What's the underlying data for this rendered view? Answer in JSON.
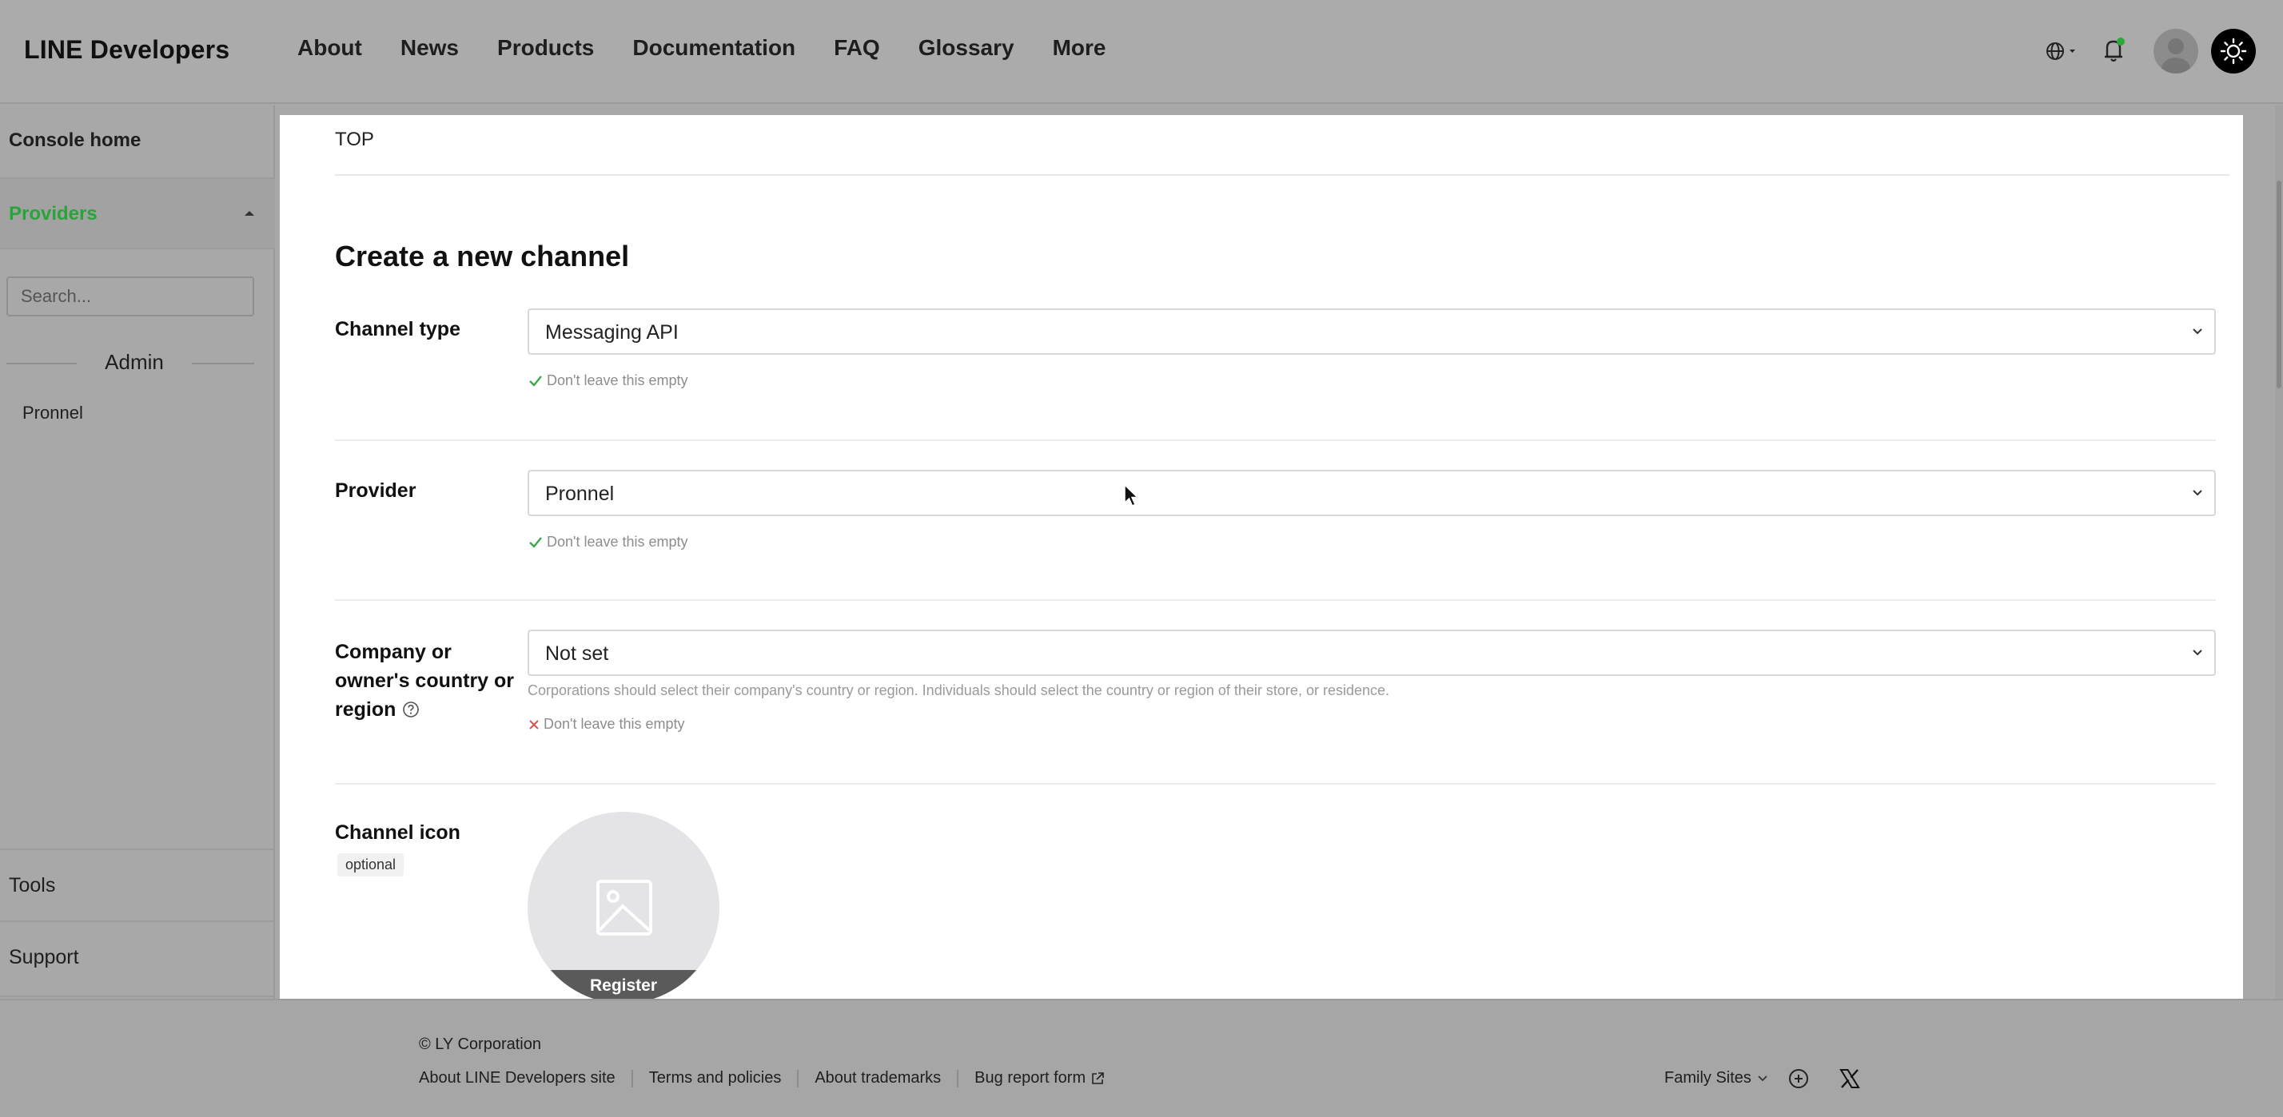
{
  "header": {
    "logo": "LINE Developers",
    "nav": [
      "About",
      "News",
      "Products",
      "Documentation",
      "FAQ",
      "Glossary",
      "More"
    ],
    "icons": [
      "globe-icon",
      "bell-icon",
      "avatar",
      "theme-toggle-icon"
    ]
  },
  "sidebar": {
    "console_home": "Console home",
    "providers": "Providers",
    "search_placeholder": "Search...",
    "group_label": "Admin",
    "provider_item": "Pronnel",
    "tools": "Tools",
    "support": "Support",
    "accent_color": "#28a43a"
  },
  "main": {
    "breadcrumb": "TOP",
    "title": "Create a new channel",
    "channel_type": {
      "label": "Channel type",
      "value": "Messaging API",
      "hint": "Don't leave this empty",
      "hint_status": "valid"
    },
    "provider": {
      "label": "Provider",
      "value": "Pronnel",
      "hint": "Don't leave this empty",
      "hint_status": "valid"
    },
    "country": {
      "label_line1": "Company or",
      "label_line2": "owner's country or",
      "label_line3": "region",
      "value": "Not set",
      "description": "Corporations should select their company's country or region. Individuals should select the country or region of their store, or residence.",
      "hint": "Don't leave this empty",
      "hint_status": "invalid"
    },
    "channel_icon": {
      "label": "Channel icon",
      "badge": "optional",
      "button": "Register"
    }
  },
  "footer": {
    "copyright": "© LY Corporation",
    "links": [
      "About LINE Developers site",
      "Terms and policies",
      "About trademarks",
      "Bug report form"
    ],
    "family_sites": "Family Sites"
  }
}
